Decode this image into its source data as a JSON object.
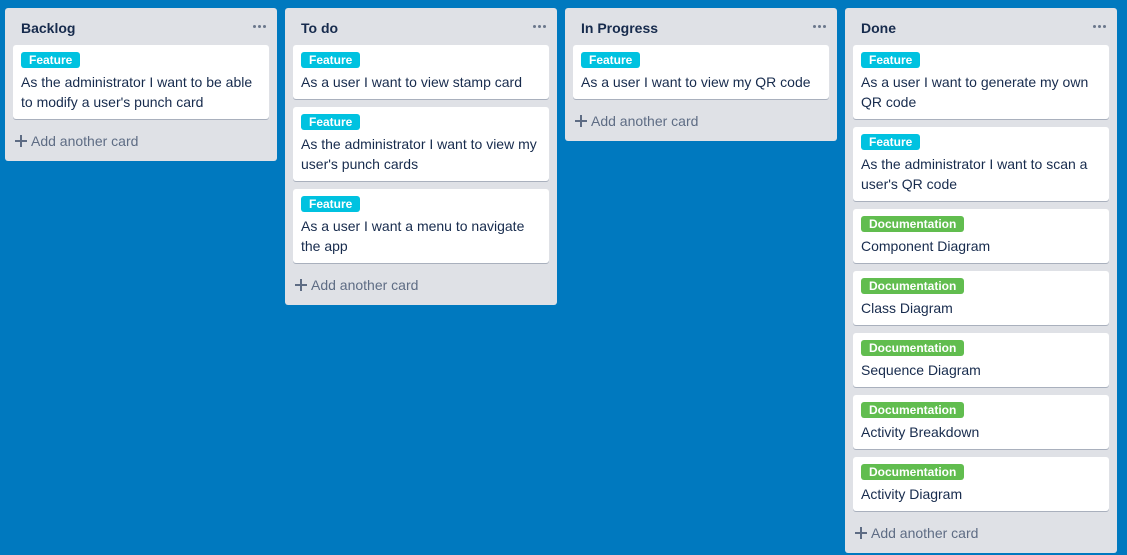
{
  "colors": {
    "board_background": "#0079bf",
    "list_background": "#dfe1e6",
    "feature_label": "#00c2e0",
    "documentation_label": "#61bd4f"
  },
  "icons": {
    "list_menu": "ellipsis-icon",
    "add": "plus-icon"
  },
  "lists": [
    {
      "title": "Backlog",
      "add_label": "Add another card",
      "cards": [
        {
          "label": "Feature",
          "label_type": "feature",
          "title": "As the administrator I want to be able to modify a user's punch card"
        }
      ]
    },
    {
      "title": "To do",
      "add_label": "Add another card",
      "cards": [
        {
          "label": "Feature",
          "label_type": "feature",
          "title": "As a user I want to view stamp card"
        },
        {
          "label": "Feature",
          "label_type": "feature",
          "title": "As the administrator I want to view my user's punch cards"
        },
        {
          "label": "Feature",
          "label_type": "feature",
          "title": "As a user I want a menu to navigate the app"
        }
      ]
    },
    {
      "title": "In Progress",
      "add_label": "Add another card",
      "cards": [
        {
          "label": "Feature",
          "label_type": "feature",
          "title": "As a user I want to view my QR code"
        }
      ]
    },
    {
      "title": "Done",
      "add_label": "Add another card",
      "cards": [
        {
          "label": "Feature",
          "label_type": "feature",
          "title": "As a user I want to generate my own QR code"
        },
        {
          "label": "Feature",
          "label_type": "feature",
          "title": "As the administrator I want to scan a user's QR code"
        },
        {
          "label": "Documentation",
          "label_type": "documentation",
          "title": "Component Diagram"
        },
        {
          "label": "Documentation",
          "label_type": "documentation",
          "title": "Class Diagram"
        },
        {
          "label": "Documentation",
          "label_type": "documentation",
          "title": "Sequence Diagram"
        },
        {
          "label": "Documentation",
          "label_type": "documentation",
          "title": "Activity Breakdown"
        },
        {
          "label": "Documentation",
          "label_type": "documentation",
          "title": "Activity Diagram"
        }
      ]
    }
  ]
}
